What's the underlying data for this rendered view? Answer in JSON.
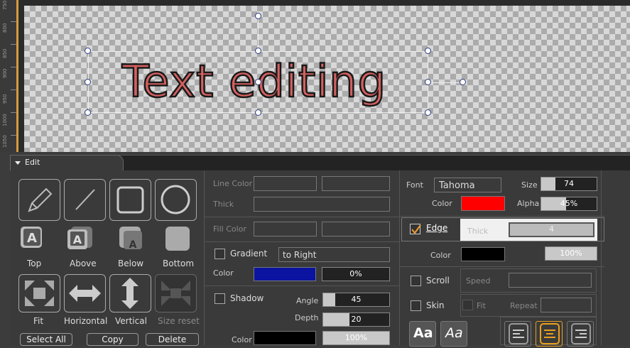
{
  "ruler": {
    "labels": [
      "1050",
      "1000",
      "950",
      "900",
      "850",
      "800",
      "750"
    ]
  },
  "canvas": {
    "text": "Text editing"
  },
  "edit_tab": {
    "label": "Edit"
  },
  "tools": {
    "top": "Top",
    "above": "Above",
    "below": "Below",
    "bottom": "Bottom",
    "fit": "Fit",
    "horizontal": "Horizontal",
    "vertical": "Vertical",
    "size_reset": "Size reset",
    "select_all": "Select All",
    "copy": "Copy",
    "delete": "Delete"
  },
  "line": {
    "color_label": "Line Color",
    "thick_label": "Thick"
  },
  "fill": {
    "color_label": "Fill Color"
  },
  "gradient": {
    "label": "Gradient",
    "direction": "to Right",
    "color_label": "Color",
    "percent": "0%",
    "color": "#0a14a0"
  },
  "shadow": {
    "label": "Shadow",
    "angle_label": "Angle",
    "angle": "45",
    "angle_fraction": 0.18,
    "depth_label": "Depth",
    "depth": "20",
    "depth_fraction": 0.4,
    "color_label": "Color",
    "percent": "100%",
    "color": "#000000"
  },
  "font": {
    "label": "Font",
    "name": "Tahoma",
    "size_label": "Size",
    "size": "74",
    "size_fraction": 0.25,
    "color_label": "Color",
    "color": "#ff0000",
    "alpha_label": "Alpha",
    "alpha": "45%",
    "alpha_fraction": 0.45
  },
  "edge": {
    "label": "Edge",
    "checked": true,
    "thick_label": "Thick",
    "thick": "4",
    "color_label": "Color",
    "color": "#000000",
    "percent": "100%"
  },
  "scroll": {
    "label": "Scroll",
    "speed_label": "Speed"
  },
  "skin": {
    "label": "Skin",
    "fit_label": "Fit",
    "repeat_label": "Repeat"
  },
  "style_buttons": {
    "bold": "Aa",
    "italic": "Aa"
  }
}
